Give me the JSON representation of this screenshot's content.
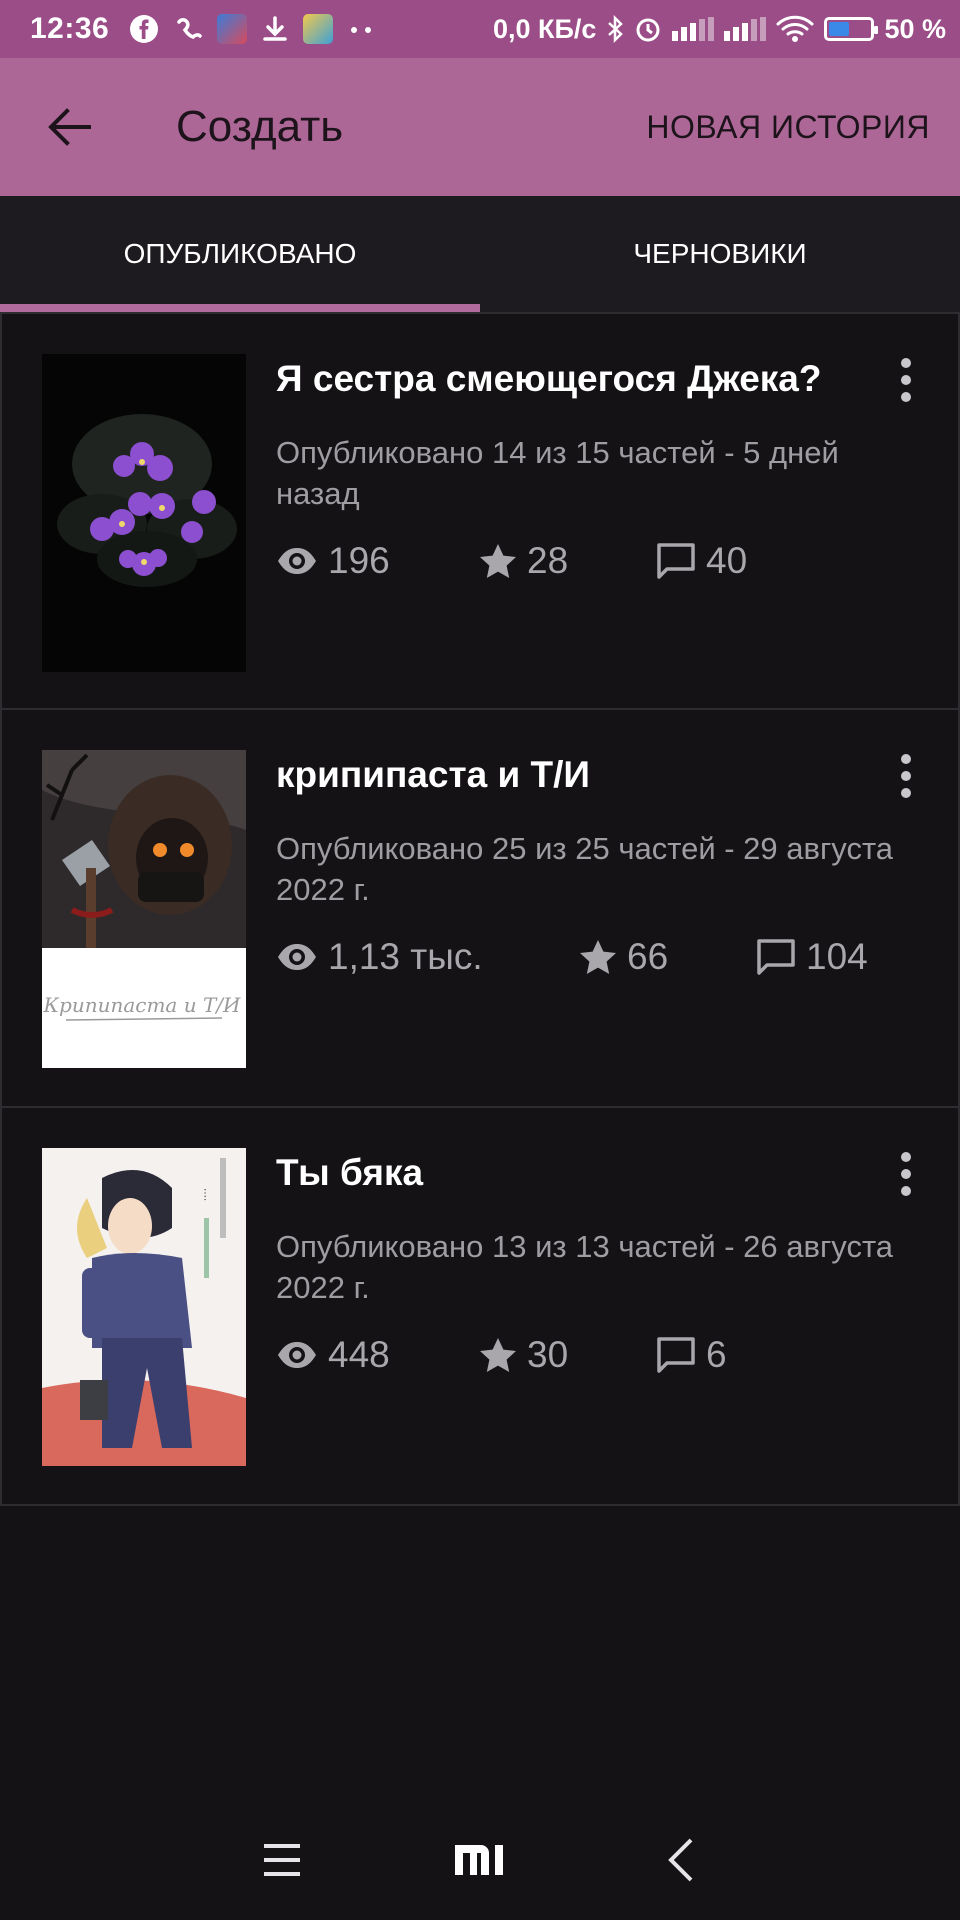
{
  "status_bar": {
    "time": "12:36",
    "network_speed": "0,0 КБ/с",
    "battery": "50 %",
    "battery_level": 0.5
  },
  "app_bar": {
    "title": "Создать",
    "new_story_label": "НОВАЯ ИСТОРИЯ"
  },
  "tabs": [
    {
      "label": "ОПУБЛИКОВАНО",
      "active": true
    },
    {
      "label": "ЧЕРНОВИКИ",
      "active": false
    }
  ],
  "stories": [
    {
      "title": "Я сестра смеющегося Джека?",
      "meta": "Опубликовано 14 из 15 частей - 5 дней назад",
      "views": "196",
      "votes": "28",
      "comments": "40"
    },
    {
      "title": "крипипаста и Т/И",
      "meta": "Опубликовано 25 из 25 частей - 29 августа 2022 г.",
      "views": "1,13 тыс.",
      "votes": "66",
      "comments": "104",
      "cover_text": "Крипипаста и Т/И"
    },
    {
      "title": "Ты бяка",
      "meta": "Опубликовано 13 из 13 частей - 26 августа 2022 г.",
      "views": "448",
      "votes": "30",
      "comments": "6"
    }
  ],
  "colors": {
    "status_bar": "#9a4d86",
    "app_bar": "#ad6797",
    "tab_indicator": "#b16b9c",
    "background": "#141215"
  },
  "icons": {
    "back": "arrow-left-icon",
    "views": "eye-icon",
    "votes": "star-icon",
    "comments": "comment-icon",
    "more": "more-vert-icon",
    "nav_menu": "menu-icon",
    "nav_home": "mi-home-icon",
    "nav_back": "chevron-left-icon"
  }
}
